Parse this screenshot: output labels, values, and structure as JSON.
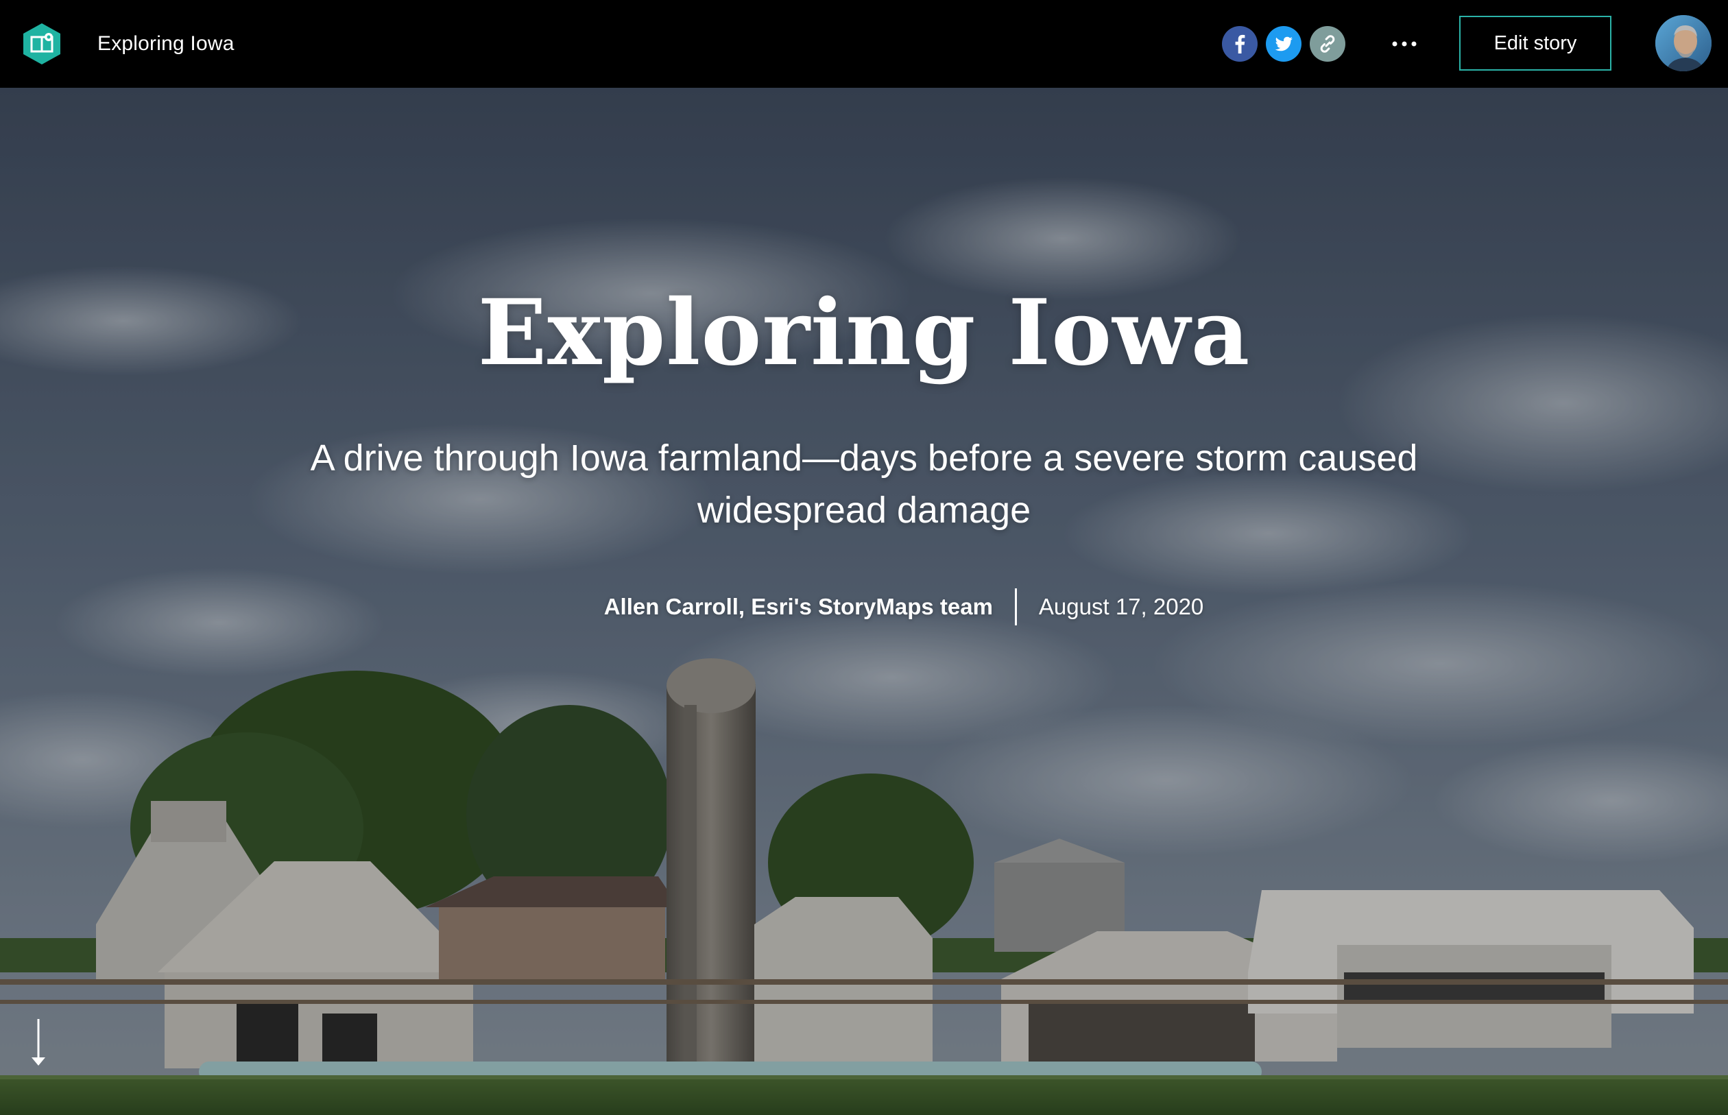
{
  "header": {
    "app_icon": "storymaps-icon",
    "title": "Exploring Iowa",
    "share": [
      {
        "icon": "facebook-icon",
        "color": "#3b5998"
      },
      {
        "icon": "twitter-icon",
        "color": "#1da1f2"
      },
      {
        "icon": "link-icon",
        "color": "#7a9c9a"
      }
    ],
    "more_icon": "ellipsis-icon",
    "edit_label": "Edit story",
    "avatar_icon": "user-avatar",
    "accent_color": "#2bb3a8"
  },
  "cover": {
    "title": "Exploring Iowa",
    "subtitle": "A drive through Iowa farmland—days before a severe storm caused widespread damage",
    "author": "Allen Carroll, Esri's StoryMaps team",
    "date": "August 17, 2020",
    "scroll_icon": "arrow-down-icon"
  }
}
